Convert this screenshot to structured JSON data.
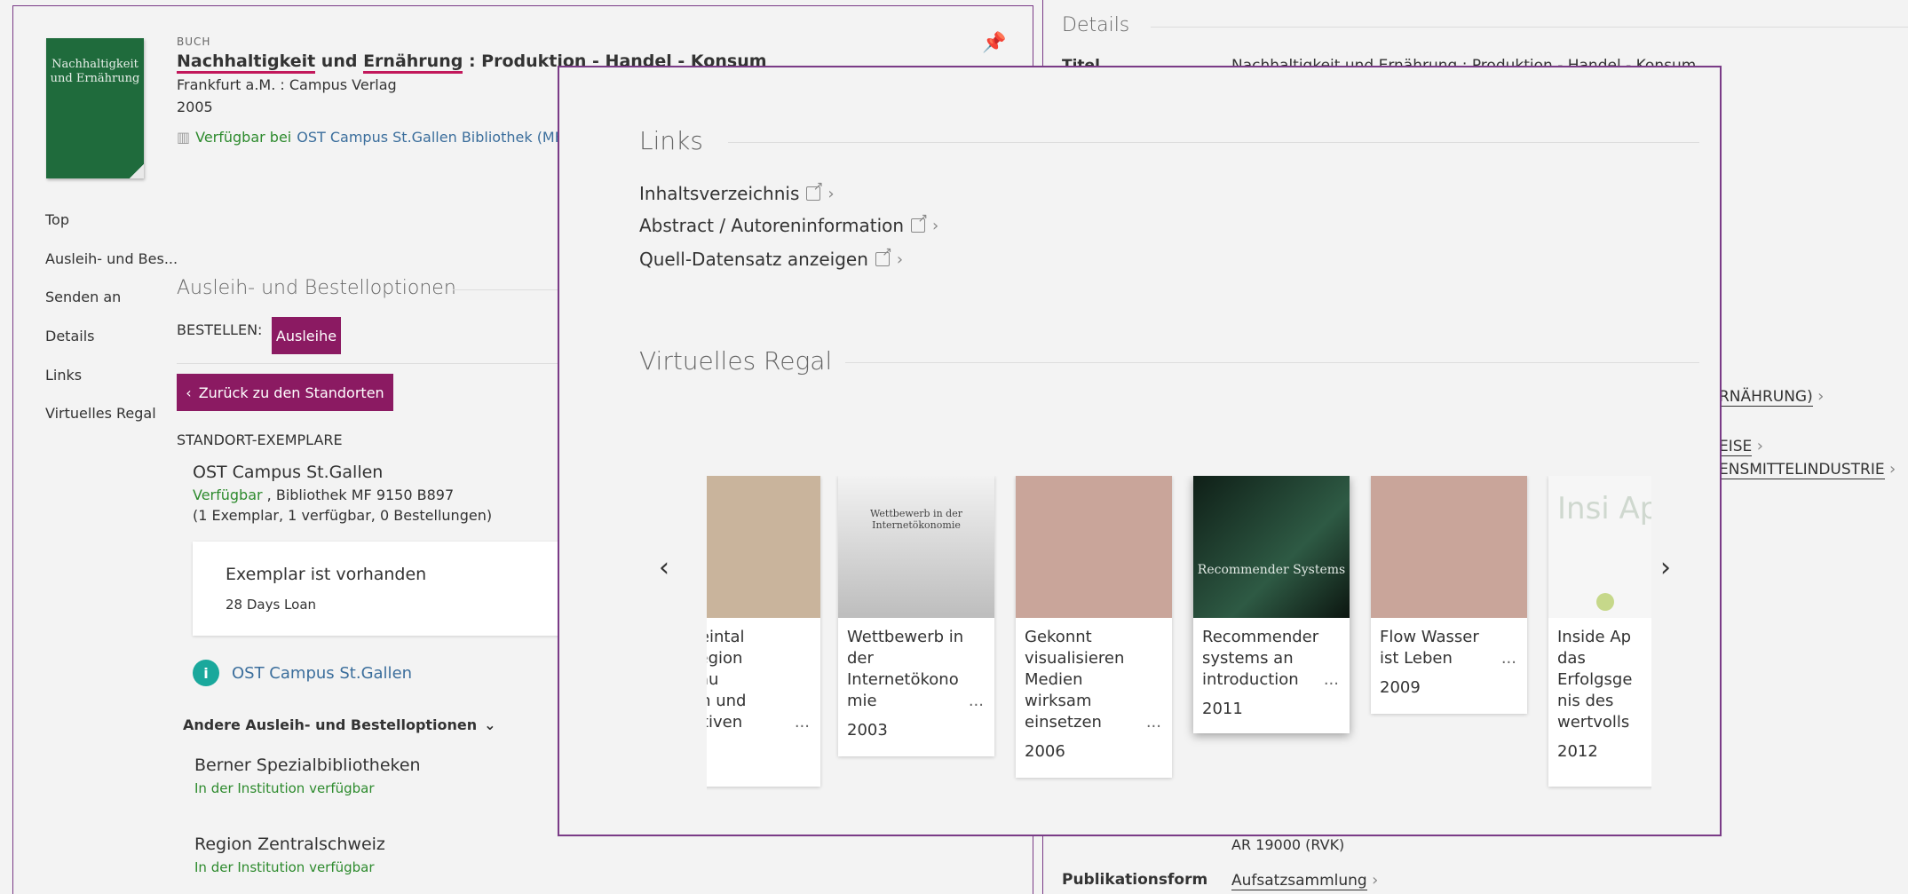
{
  "record": {
    "type_label": "BUCH",
    "title_part1": "Nachhaltigkeit",
    "title_part2": " und ",
    "title_part3": "Ernährung",
    "title_part4": " : Produktion - Handel - Konsum",
    "publisher": "Frankfurt a.M. : Campus Verlag",
    "year": "2005",
    "availability": "Verfügbar bei",
    "availability_location": "OST Campus St.Gallen  Bibliothek (MF",
    "cover_lines": [
      "Nachhaltigkeit",
      "und Ernährung"
    ]
  },
  "nav": {
    "items": [
      "Top",
      "Ausleih- und Bes...",
      "Senden an",
      "Details",
      "Links",
      "Virtuelles Regal"
    ]
  },
  "loan": {
    "section_title": "Ausleih- und Bestelloptionen",
    "order_label": "BESTELLEN:",
    "order_button": "Ausleihe",
    "back_button": "Zurück zu den Standorten",
    "holdings_label": "STANDORT-EXEMPLARE",
    "location_name": "OST Campus St.Gallen",
    "location_status": "Verfügbar",
    "location_shelf": " , Bibliothek MF 9150 B897",
    "location_counts": "(1 Exemplar, 1 verfügbar, 0 Bestellungen)",
    "item_status": "Exemplar ist vorhanden",
    "item_policy": "28 Days Loan",
    "info_link": "OST Campus St.Gallen",
    "other_options": "Andere Ausleih- und Bestelloptionen",
    "other": [
      {
        "name": "Berner Spezialbibliotheken",
        "status": "In der Institution verfügbar"
      },
      {
        "name": "Region Zentralschweiz",
        "status": "In der Institution verfügbar"
      }
    ]
  },
  "details": {
    "section_title": "Details",
    "title_label": "Titel",
    "title_value": "Nachhaltigkeit und Ernährung : Produktion - Handel - Konsum",
    "subject1": "RNÄHRUNG)",
    "subject2": "EISE",
    "subject3": "ENSMITTELINDUSTRIE",
    "classification_cut": "AR 19000 (RVK)",
    "pubform_label": "Publikationsform",
    "pubform_value": "Aufsatzsammlung"
  },
  "overlay": {
    "links_title": "Links",
    "links": [
      "Inhaltsverzeichnis",
      "Abstract / Autoreninformation",
      "Quell-Datensatz anzeigen"
    ],
    "shelf_title": "Virtuelles Regal",
    "books": [
      {
        "lines": [
          "nrheintal",
          "e Region",
          "mbau",
          "ysen und",
          "pektiven"
        ],
        "year": "",
        "color": "#c9b49c"
      },
      {
        "lines": [
          "Wettbewerb in",
          "der",
          "Internetökono",
          "mie"
        ],
        "year": "2003",
        "color": "#cfcfcf"
      },
      {
        "lines": [
          "Gekonnt",
          "visualisieren",
          "Medien",
          "wirksam",
          "einsetzen"
        ],
        "year": "2006",
        "color": "#c9a59a"
      },
      {
        "lines": [
          "Recommender",
          "systems an",
          "introduction"
        ],
        "year": "2011",
        "color": "#213a2c"
      },
      {
        "lines": [
          "Flow Wasser",
          "ist Leben"
        ],
        "year": "2009",
        "color": "#c9a59a"
      },
      {
        "lines": [
          "Inside Ap",
          "das",
          "Erfolgsge",
          "nis des",
          "wertvolls"
        ],
        "year": "2012",
        "color": "#f6f6f6"
      }
    ],
    "cover_text": {
      "wettbewerb": "Wettbewerb in der Internetökonomie",
      "recommender": "Recommender Systems",
      "inside_app": "Insi App"
    }
  }
}
